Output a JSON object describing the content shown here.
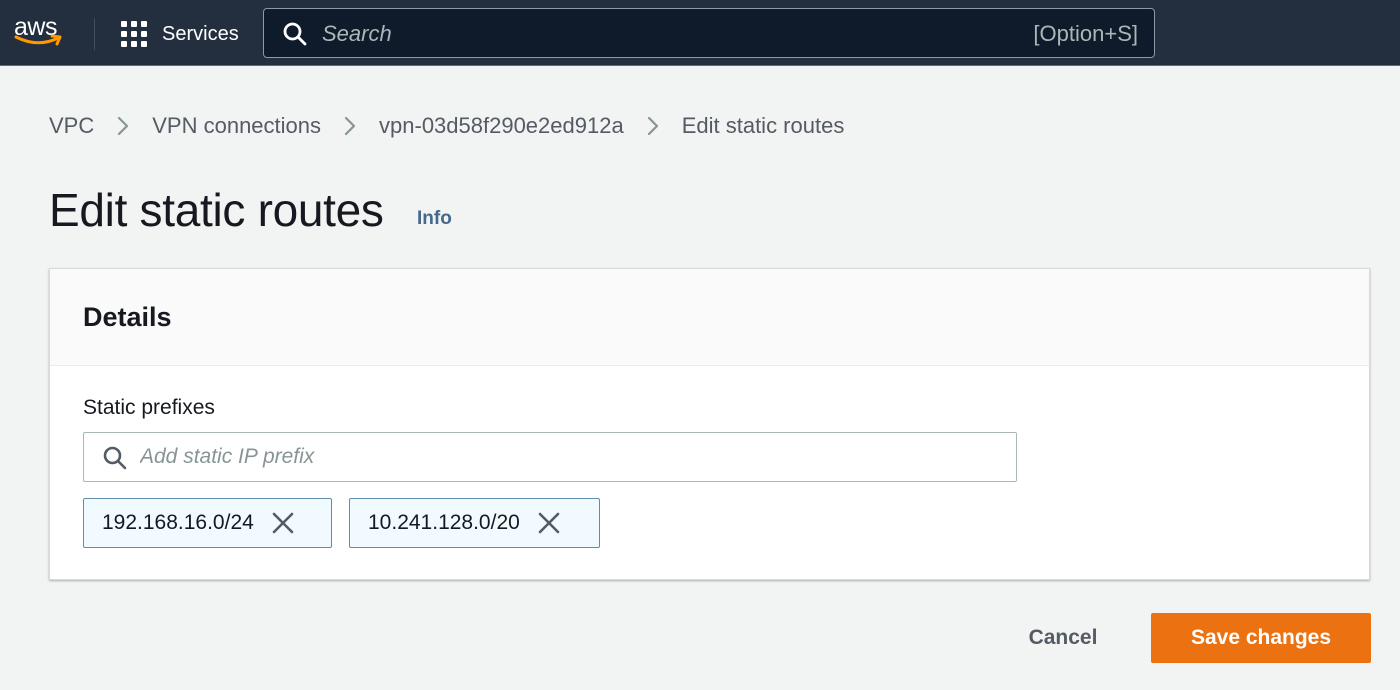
{
  "colors": {
    "topbar": "#232f3e",
    "accent_orange": "#ec7211",
    "link_blue": "#44698a",
    "token_bg": "#f1faff",
    "token_border": "#5f8dab"
  },
  "topbar": {
    "logo_text": "aws",
    "services_label": "Services",
    "search": {
      "placeholder": "Search",
      "shortcut": "[Option+S]"
    }
  },
  "breadcrumb": {
    "items": [
      {
        "label": "VPC"
      },
      {
        "label": "VPN connections"
      },
      {
        "label": "vpn-03d58f290e2ed912a"
      },
      {
        "label": "Edit static routes"
      }
    ]
  },
  "page": {
    "title": "Edit static routes",
    "info_label": "Info"
  },
  "details": {
    "title": "Details",
    "field_label": "Static prefixes",
    "input_placeholder": "Add static IP prefix",
    "input_value": "",
    "tokens": [
      {
        "label": "192.168.16.0/24"
      },
      {
        "label": "10.241.128.0/20"
      }
    ]
  },
  "actions": {
    "cancel_label": "Cancel",
    "save_label": "Save changes"
  },
  "icons": {
    "services": "grid-icon",
    "search": "search-icon",
    "breadcrumb_separator": "chevron-right-icon",
    "token_remove": "close-icon"
  }
}
